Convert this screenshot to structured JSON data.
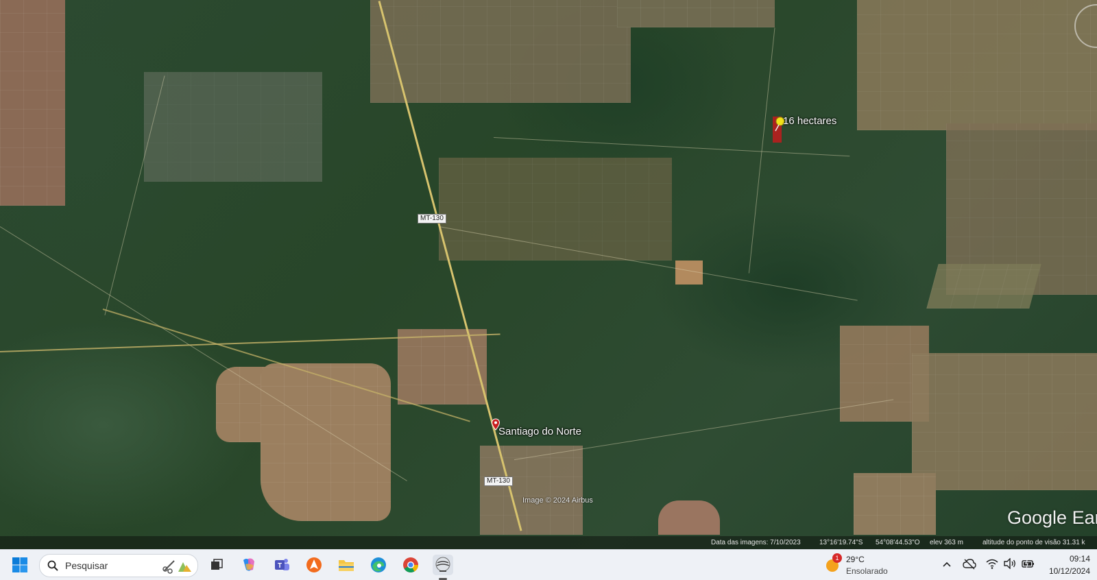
{
  "map": {
    "place_label": "Santiago do Norte",
    "pin_label": "16 hectares",
    "road_shield_1": "MT-130",
    "road_shield_2": "MT-130",
    "copyright": "Image © 2024 Airbus",
    "logo": "Google Ear",
    "colors": {
      "road": "#d7c36e",
      "pin_marker": "#c81e1e",
      "pushpin": "#f2e21a"
    }
  },
  "status_bar": {
    "imagery_date": "Data das imagens: 7/10/2023",
    "latitude": "13°16'19.74\"S",
    "longitude": "54°08'44.53\"O",
    "elevation": "elev  363 m",
    "eye_altitude": "altitude do ponto de visão  31.31 k"
  },
  "taskbar": {
    "search_placeholder": "Pesquisar",
    "weather_temp": "29°C",
    "weather_desc": "Ensolarado",
    "weather_badge": "1",
    "time": "09:14",
    "date": "10/12/2024",
    "icons": [
      "windows-start-icon",
      "search-icon",
      "snipping-tool-icon",
      "task-view-icon",
      "copilot-icon",
      "teams-icon",
      "avast-icon",
      "file-explorer-icon",
      "edge-icon",
      "chrome-icon",
      "google-earth-icon"
    ]
  }
}
